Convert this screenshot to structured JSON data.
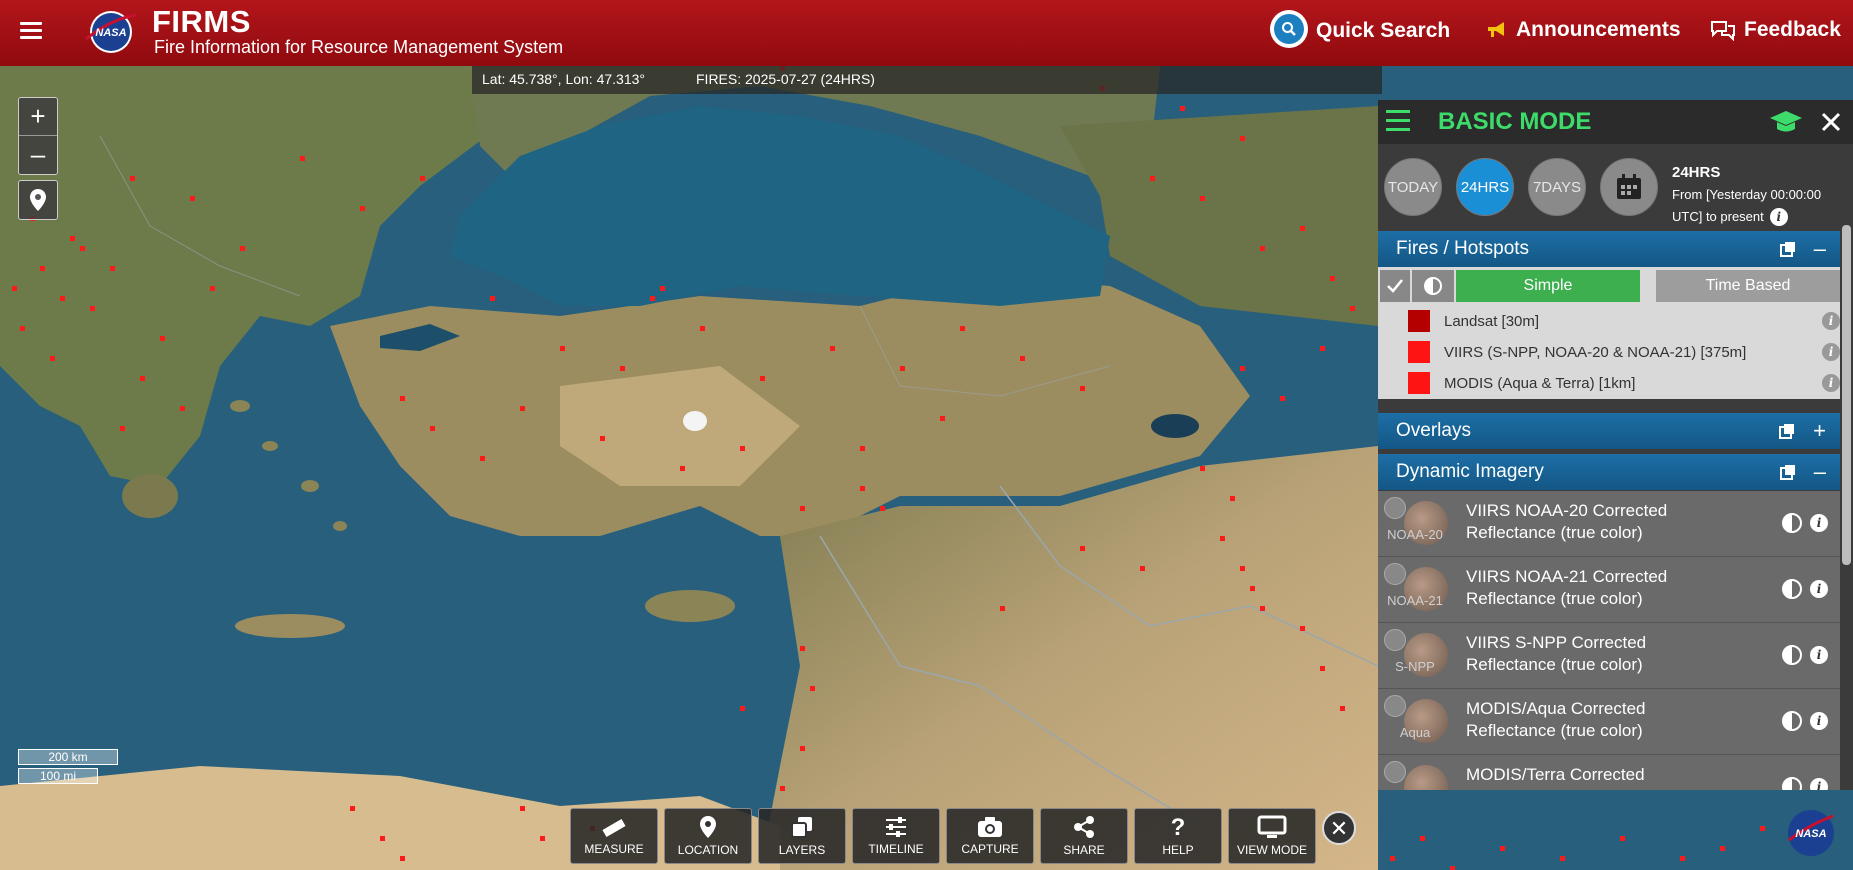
{
  "header": {
    "menu_icon": "hamburger-icon",
    "logo_text": "NASA",
    "brand": "FIRMS",
    "subtitle": "Fire Information for Resource Management System",
    "quick_search": "Quick Search",
    "announcements": "Announcements",
    "feedback": "Feedback"
  },
  "map": {
    "coordinates": "Lat: 45.738°, Lon: 47.313°",
    "fires_status": "FIRES: 2025-07-27 (24HRS)",
    "zoom_in": "+",
    "zoom_out": "–",
    "scale_km": "200 km",
    "scale_mi": "100 mi",
    "fire_color": "#ff1a1a"
  },
  "toolbar": {
    "items": [
      {
        "label": "MEASURE",
        "icon": "ruler-icon"
      },
      {
        "label": "LOCATION",
        "icon": "map-pin-icon"
      },
      {
        "label": "LAYERS",
        "icon": "layers-icon"
      },
      {
        "label": "TIMELINE",
        "icon": "sliders-icon"
      },
      {
        "label": "CAPTURE",
        "icon": "camera-icon"
      },
      {
        "label": "SHARE",
        "icon": "share-icon"
      },
      {
        "label": "HELP",
        "icon": "question-icon"
      },
      {
        "label": "VIEW MODE",
        "icon": "monitor-icon"
      }
    ],
    "close": "✕"
  },
  "panel": {
    "title": "BASIC MODE",
    "accent": "#3ddc6a",
    "time_buttons": [
      "TODAY",
      "24HRS",
      "7DAYS"
    ],
    "active_time": "24HRS",
    "time_title": "24HRS",
    "time_desc_1": "From [Yesterday 00:00:00",
    "time_desc_2": "UTC] to present",
    "fires": {
      "title": "Fires / Hotspots",
      "mode_simple": "Simple",
      "mode_time": "Time Based",
      "layers": [
        {
          "label": "Landsat [30m]",
          "color": "#b50000"
        },
        {
          "label": "VIIRS (S-NPP, NOAA-20 & NOAA-21) [375m]",
          "color": "#ff1414"
        },
        {
          "label": "MODIS (Aqua & Terra) [1km]",
          "color": "#ff1414"
        }
      ]
    },
    "overlays": {
      "title": "Overlays"
    },
    "imagery": {
      "title": "Dynamic Imagery",
      "items": [
        {
          "tag": "NOAA-20",
          "line1": "VIIRS NOAA-20 Corrected",
          "line2": "Reflectance (true color)"
        },
        {
          "tag": "NOAA-21",
          "line1": "VIIRS NOAA-21 Corrected",
          "line2": "Reflectance (true color)"
        },
        {
          "tag": "S-NPP",
          "line1": "VIIRS S-NPP Corrected",
          "line2": "Reflectance (true color)"
        },
        {
          "tag": "Aqua",
          "line1": "MODIS/Aqua Corrected",
          "line2": "Reflectance (true color)"
        },
        {
          "tag": "",
          "line1": "MODIS/Terra Corrected",
          "line2": ""
        }
      ]
    }
  }
}
